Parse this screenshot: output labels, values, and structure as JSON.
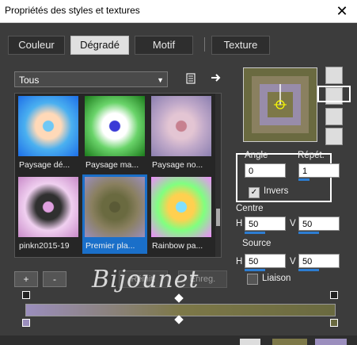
{
  "window": {
    "title": "Propriétés des styles et textures",
    "close": "✕"
  },
  "tabs": [
    {
      "label": "Couleur"
    },
    {
      "label": "Dégradé"
    },
    {
      "label": "Motif"
    },
    {
      "label": "Texture"
    }
  ],
  "category": {
    "selected": "Tous"
  },
  "gradients": [
    {
      "label": "Paysage dé...",
      "colors": [
        "#1e6fe8",
        "#4ab0f0",
        "#ffd9b8",
        "#70c8f5"
      ]
    },
    {
      "label": "Paysage ma...",
      "colors": [
        "#1b7a1b",
        "#6ad46a",
        "#ffffff",
        "#3a3ad6"
      ]
    },
    {
      "label": "Paysage no...",
      "colors": [
        "#8b7fb0",
        "#c0a9c9",
        "#e3c5d3",
        "#c7808f"
      ]
    },
    {
      "label": "pinkn2015-19",
      "colors": [
        "#c98bc9",
        "#f0d0f0",
        "#303030",
        "#e0a0e0"
      ]
    },
    {
      "label": "Premier pla...",
      "colors": [
        "#9b8ebd",
        "#8a8060",
        "#6a6a40",
        "#5a5a36"
      ]
    },
    {
      "label": "Rainbow pa...",
      "colors": [
        "#f08aff",
        "#80ff80",
        "#ffd050",
        "#80e0ff"
      ]
    }
  ],
  "angle": {
    "label": "Angle",
    "value": "0"
  },
  "repeat": {
    "label": "Répét.",
    "value": "1"
  },
  "invert": {
    "label": "Invers"
  },
  "center": {
    "label": "Centre",
    "h_label": "H",
    "h_value": "50",
    "v_label": "V",
    "v_value": "50"
  },
  "source": {
    "label": "Source",
    "h_label": "H",
    "h_value": "50",
    "v_label": "V",
    "v_value": "50"
  },
  "link": {
    "label": "Liaison"
  },
  "stops": {
    "add": "+",
    "remove": "-",
    "reset": "Réinit.",
    "save": "Enreg."
  },
  "watermark": "Bijounet"
}
